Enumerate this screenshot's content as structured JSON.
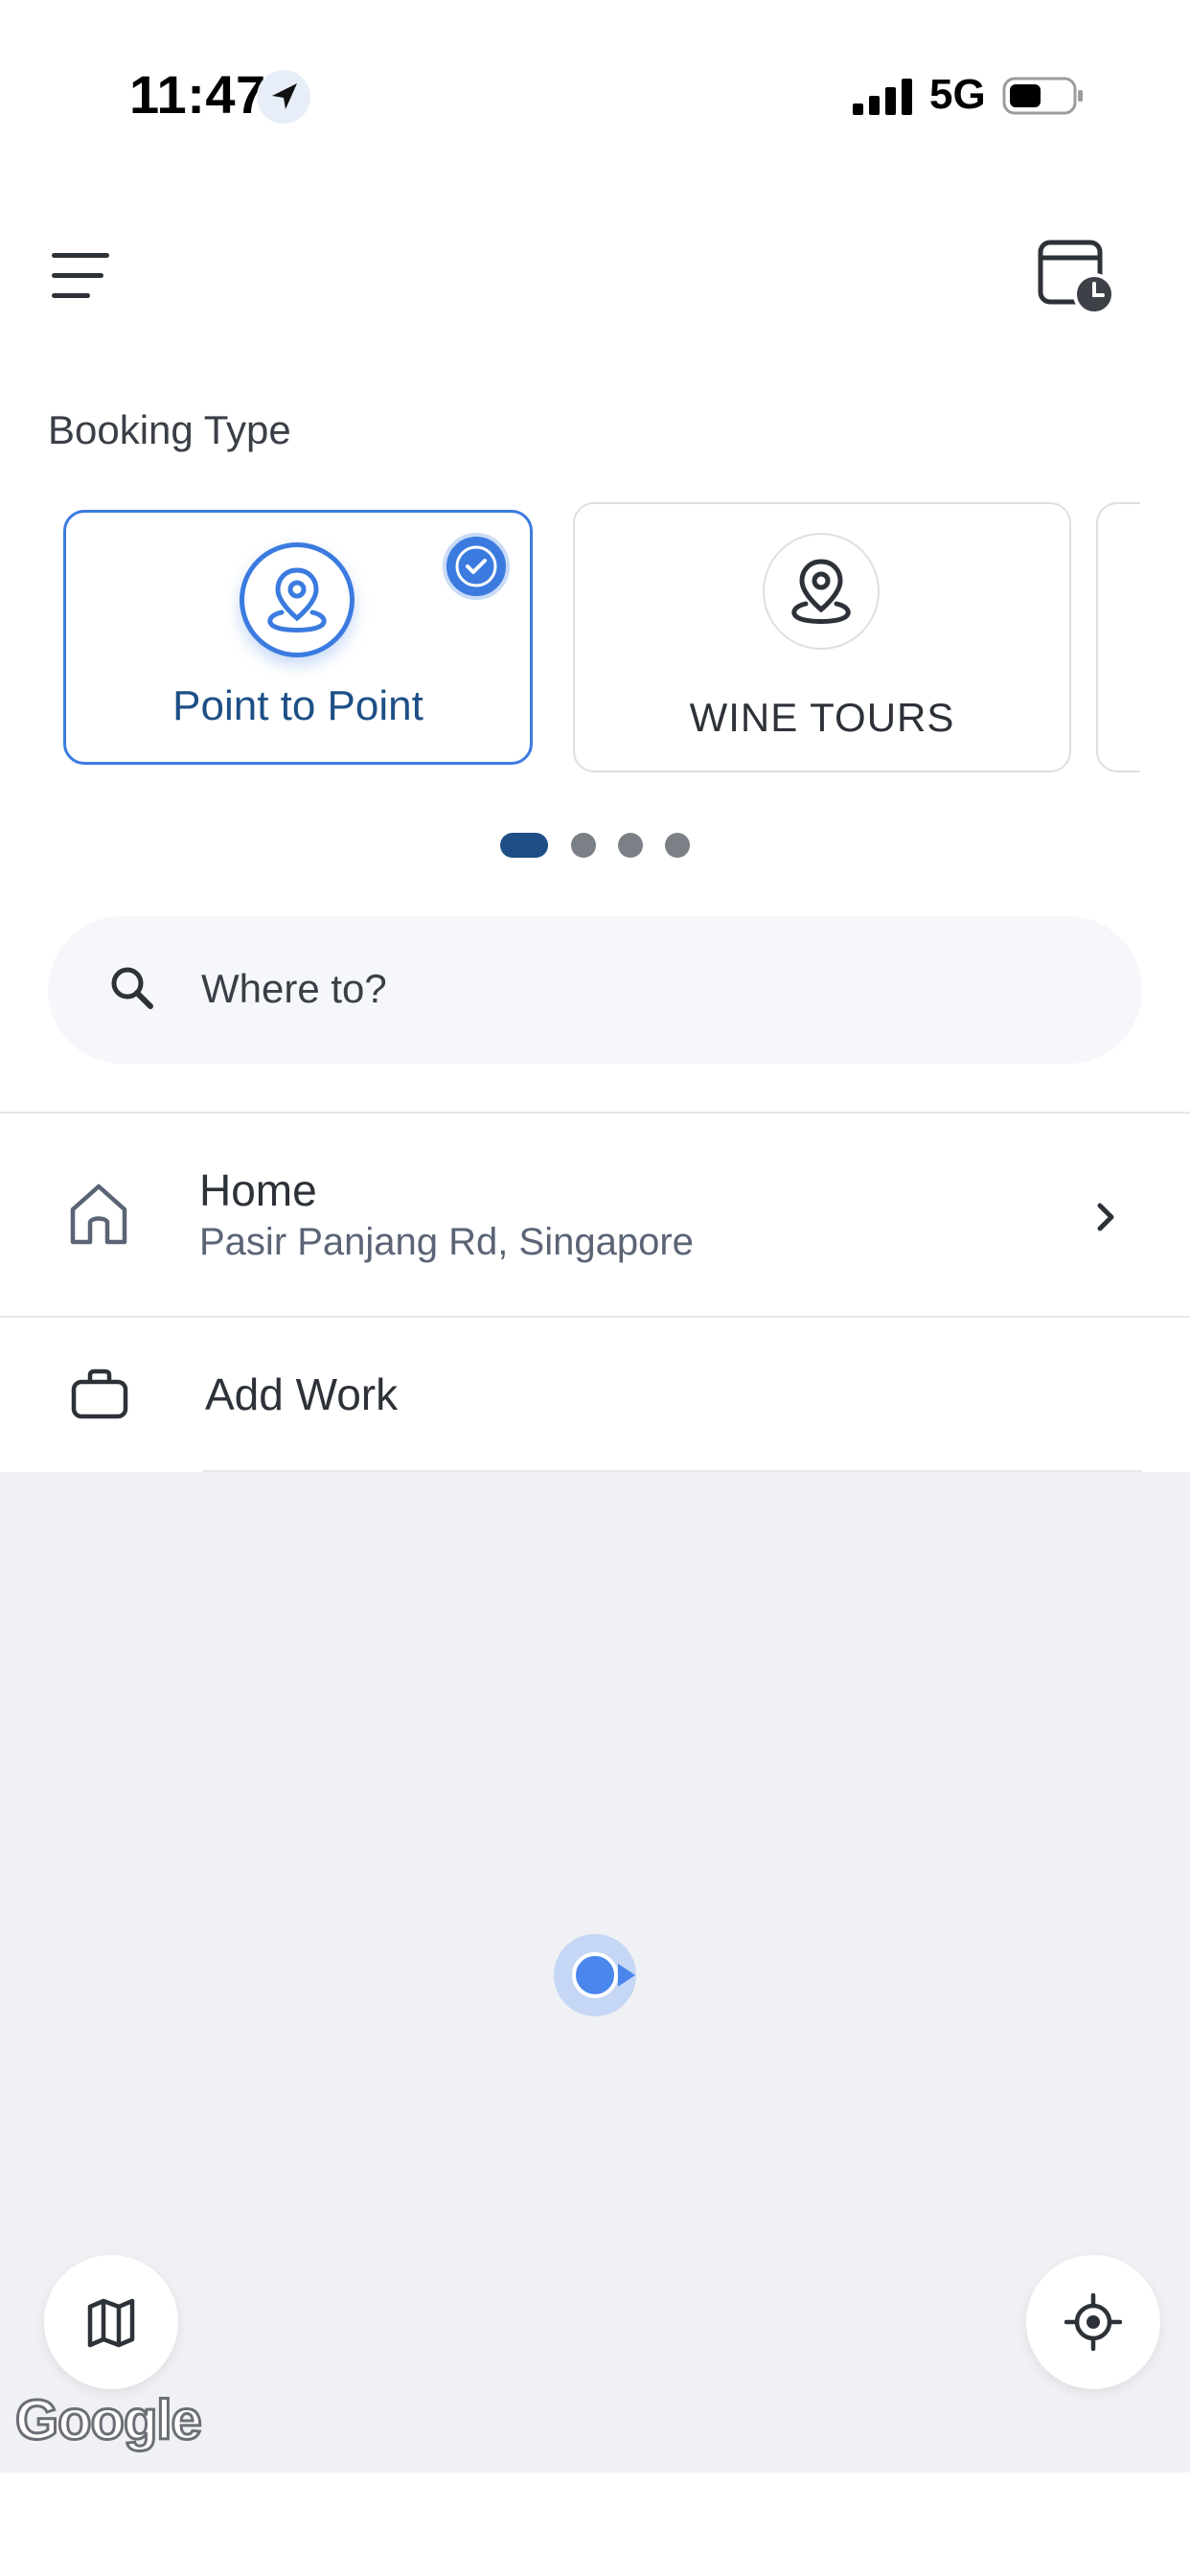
{
  "status_bar": {
    "time": "11:47",
    "network": "5G"
  },
  "header": {
    "menu_icon": "hamburger-menu-icon",
    "history_icon": "calendar-clock-icon"
  },
  "booking": {
    "label": "Booking Type",
    "cards": [
      {
        "label": "Point to Point",
        "icon": "location-pin-icon",
        "selected": true
      },
      {
        "label": "WINE TOURS",
        "icon": "location-pin-icon",
        "selected": false
      }
    ],
    "pages": {
      "total": 4,
      "active": 1
    }
  },
  "search": {
    "placeholder": "Where to?"
  },
  "saved_places": {
    "home": {
      "title": "Home",
      "subtitle": "Pasir Panjang Rd, Singapore"
    },
    "work": {
      "title": "Add Work"
    }
  },
  "map": {
    "attribution": "Google"
  },
  "colors": {
    "accent": "#3b7be0",
    "brand_dark": "#1d4f86",
    "map_bg": "#f0f1f4"
  }
}
